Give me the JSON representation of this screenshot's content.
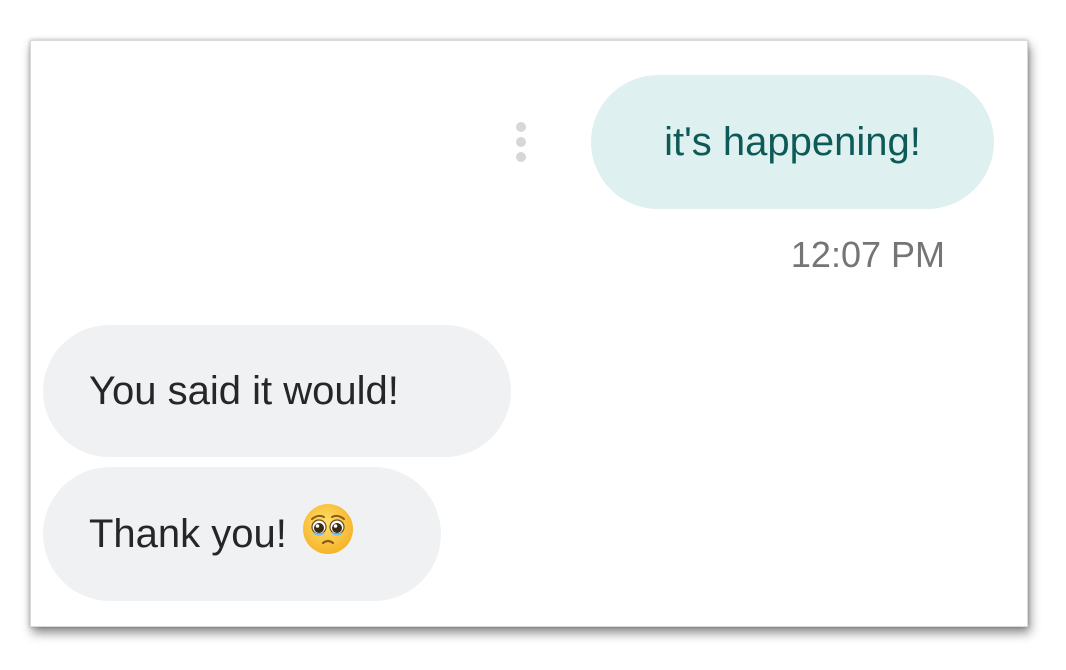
{
  "conversation": {
    "messages": [
      {
        "direction": "outgoing",
        "text": "it's happening!",
        "timestamp": "12:07 PM"
      },
      {
        "direction": "incoming",
        "text": "You said it would!"
      },
      {
        "direction": "incoming",
        "text": "Thank you!",
        "emoji": "pleading-face-emoji"
      }
    ]
  },
  "icons": {
    "more": "more-vertical-icon",
    "emoji": "pleading-face-emoji"
  },
  "colors": {
    "outgoing_bubble": "#dff0f0",
    "outgoing_text": "#0d5a57",
    "incoming_bubble": "#f0f1f3",
    "incoming_text": "#262626",
    "timestamp": "#757575"
  }
}
